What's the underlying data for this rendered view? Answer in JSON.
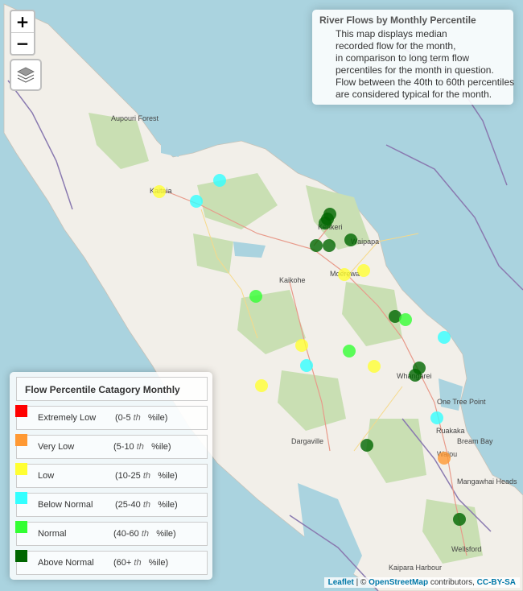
{
  "map": {
    "zoom_in_label": "+",
    "zoom_out_label": "−",
    "layers_icon": "layers-icon"
  },
  "info": {
    "title": "River Flows by Monthly Percentile",
    "lines": [
      "This map displays median",
      "recorded flow for the month,",
      "in comparison to long term flow",
      "percentiles for the month in question.",
      "Flow between the 40th to 60th percentiles",
      "are considered typical for the month."
    ]
  },
  "legend": {
    "title": "Flow Percentile Catagory Monthly",
    "items": [
      {
        "label": "Extremely Low",
        "range_open": "(0-5",
        "suffix": "th",
        "range_close": "%ile)",
        "color": "#ff0000"
      },
      {
        "label": "Very Low",
        "range_open": "(5-10",
        "suffix": "th",
        "range_close": "%ile)",
        "color": "#ff9933"
      },
      {
        "label": "Low",
        "range_open": "(10-25",
        "suffix": "th",
        "range_close": "%ile)",
        "color": "#ffff33"
      },
      {
        "label": "Below Normal",
        "range_open": "(25-40",
        "suffix": "th",
        "range_close": "%ile)",
        "color": "#33ffff"
      },
      {
        "label": "Normal",
        "range_open": "(40-60",
        "suffix": "th",
        "range_close": "%ile)",
        "color": "#33ff33"
      },
      {
        "label": "Above Normal",
        "range_open": "(60+",
        "suffix": "th",
        "range_close": "%ile)",
        "color": "#006600"
      }
    ]
  },
  "places": [
    "Aupouri Forest",
    "Kaitaia",
    "Kerikeri",
    "Waipapa",
    "Moerewa",
    "Kaikohe",
    "Whangarei",
    "One Tree Point",
    "Ruakaka",
    "Bream Bay",
    "Waipu",
    "Dargaville",
    "Mangawhai Heads",
    "Wellsford",
    "Kaipara Harbour"
  ],
  "attribution": {
    "leaflet": "Leaflet",
    "sep": " | © ",
    "osm": "OpenStreetMap",
    "contributors": " contributors, ",
    "license": "CC-BY-SA"
  }
}
